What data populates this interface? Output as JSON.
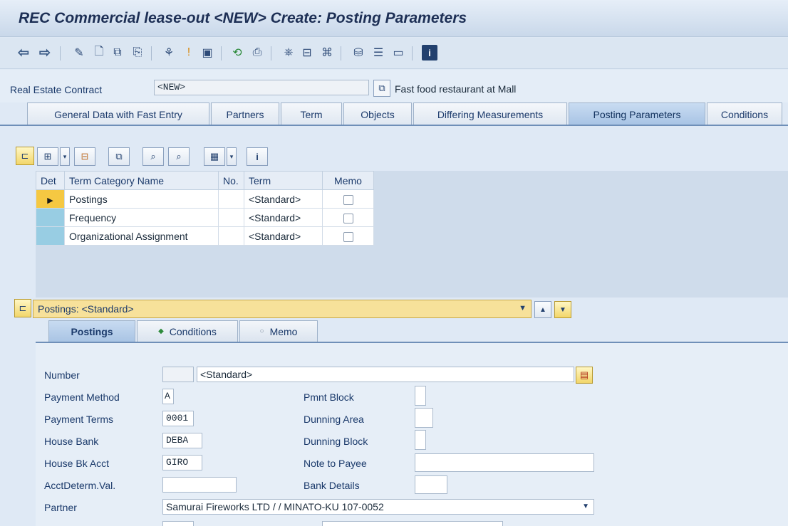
{
  "window": {
    "title": "REC Commercial lease-out <NEW> Create: Posting Parameters"
  },
  "toolbar_icons": [
    "back-icon",
    "forward-icon",
    "pencil-icon",
    "new-document-icon",
    "copy-icon",
    "other-object-icon",
    "hierarchy-icon",
    "warning-icon",
    "save-icon",
    "check-icon",
    "print-icon",
    "attachment-icon",
    "display-icon",
    "layout-icon",
    "graph-icon",
    "tree-icon",
    "screen-icon",
    "info-icon"
  ],
  "header": {
    "contract_label": "Real Estate Contract",
    "contract_value": "<NEW>",
    "description": "Fast food restaurant at Mall"
  },
  "tabs": [
    {
      "label": "General Data with Fast Entry",
      "active": false
    },
    {
      "label": "Partners",
      "active": false
    },
    {
      "label": "Term",
      "active": false
    },
    {
      "label": "Objects",
      "active": false
    },
    {
      "label": "Differing Measurements",
      "active": false
    },
    {
      "label": "Posting Parameters",
      "active": true
    },
    {
      "label": "Conditions",
      "active": false
    }
  ],
  "grid": {
    "columns": [
      "Det",
      "Term Category Name",
      "No.",
      "Term",
      "Memo"
    ],
    "rows": [
      {
        "name": "Postings",
        "no": "",
        "term": "<Standard>",
        "memo": false,
        "current": true
      },
      {
        "name": "Frequency",
        "no": "",
        "term": "<Standard>",
        "memo": false,
        "current": false
      },
      {
        "name": "Organizational Assignment",
        "no": "",
        "term": "<Standard>",
        "memo": false,
        "current": false
      }
    ]
  },
  "detail": {
    "title": "Postings: <Standard>",
    "subtabs": [
      {
        "label": "Postings",
        "active": true
      },
      {
        "label": "Conditions",
        "active": false,
        "marker": "◆"
      },
      {
        "label": "Memo",
        "active": false,
        "marker": "○"
      }
    ]
  },
  "form": {
    "number_label": "Number",
    "number_value": "",
    "number_name": "<Standard>",
    "payment_method_label": "Payment Method",
    "payment_method_value": "A",
    "payment_terms_label": "Payment Terms",
    "payment_terms_value": "0001",
    "house_bank_label": "House Bank",
    "house_bank_value": "DEBA",
    "house_bk_acct_label": "House Bk Acct",
    "house_bk_acct_value": "GIRO",
    "acct_determ_label": "AcctDeterm.Val.",
    "acct_determ_value": "",
    "pmnt_block_label": "Pmnt Block",
    "pmnt_block_value": "",
    "dunning_area_label": "Dunning Area",
    "dunning_area_value": "",
    "dunning_block_label": "Dunning Block",
    "dunning_block_value": "",
    "note_to_payee_label": "Note to Payee",
    "note_to_payee_value": "",
    "bank_details_label": "Bank Details",
    "bank_details_value": "",
    "partner_label": "Partner",
    "partner_value": "Samurai Fireworks LTD / / MINATO-KU 107-0052"
  },
  "colors": {
    "title": "#1d2f55",
    "active_tab": "#a7c3e4",
    "current_row": "#f5c842",
    "row_selector": "#98cde3",
    "detail_bar": "#f7e19a"
  }
}
